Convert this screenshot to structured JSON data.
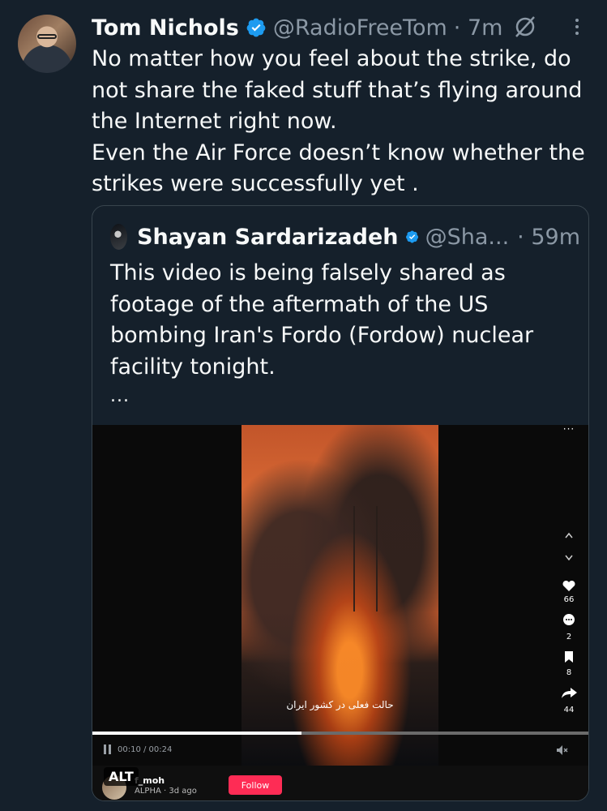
{
  "tweet": {
    "author_name": "Tom Nichols",
    "author_handle": "@RadioFreeTom",
    "time": "· 7m",
    "text_lines": [
      "No matter how you feel about the strike, do",
      "not share the faked stuff that’s flying around",
      "the Internet right now.",
      "Even the Air Force doesn’t know whether the",
      "strikes were successfully yet ."
    ],
    "verified_color": "#1d9bf0"
  },
  "quote": {
    "author_name": "Shayan Sardarizadeh",
    "author_handle": "@Sha...",
    "time": "· 59m",
    "text_lines": [
      "This video is being falsely shared as",
      "footage of the aftermath of the US",
      "bombing Iran's Fordo (Fordow) nuclear",
      "facility tonight."
    ],
    "more": "...",
    "media": {
      "overlay_caption": "حالت فعلی در کشور ایران",
      "likes": "66",
      "comments": "2",
      "saves": "8",
      "shares": "44",
      "elapsed": "00:10 / 00:24",
      "progress": 0.42,
      "alt_label": "ALT",
      "username": "f_moh",
      "sub": "ALPHA · 3d ago",
      "follow_label": "Follow",
      "follow_color": "#fe2c55"
    }
  },
  "icons": [
    "verified-badge-icon",
    "grok-icon",
    "more-options-icon",
    "heart-icon",
    "comment-icon",
    "bookmark-icon",
    "share-icon",
    "pause-icon",
    "mute-icon"
  ]
}
